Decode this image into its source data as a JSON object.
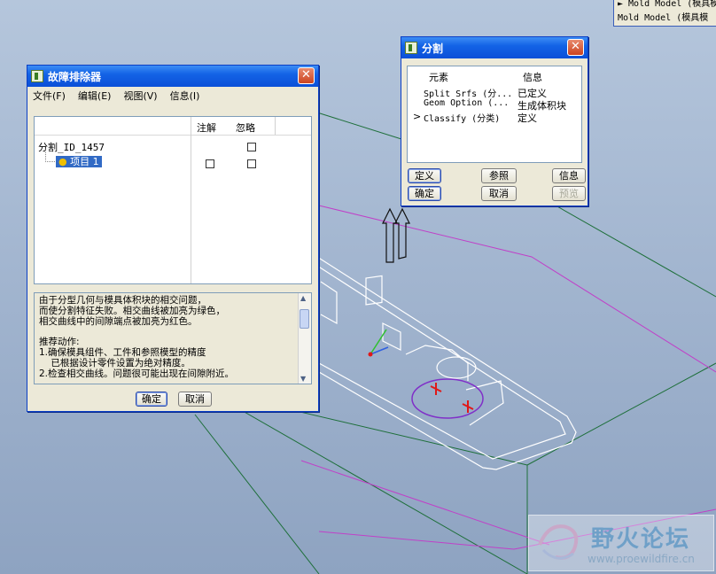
{
  "corner_panel": {
    "line1": "► Mold Model (模具模",
    "line2": "Mold Model (模具模"
  },
  "troubleshooter": {
    "title": "故障排除器",
    "menu": [
      "文件(F)",
      "编辑(E)",
      "视图(V)",
      "信息(I)"
    ],
    "col_note": "注解",
    "col_ignore": "忽略",
    "tree_root": "分割_ID_1457",
    "tree_child": "项目 1",
    "message_lines": [
      "由于分型几何与模具体积块的相交问题，",
      "而使分割特征失败。相交曲线被加亮为绿色，",
      "相交曲线中的间隙端点被加亮为红色。",
      "",
      "推荐动作:",
      "1.确保模具组件、工件和参照模型的精度",
      "    已根据设计零件设置为绝对精度。",
      "2.检查相交曲线。问题很可能出现在间隙附近。"
    ],
    "ok_label": "确定",
    "cancel_label": "取消"
  },
  "split_dialog": {
    "title": "分割",
    "col_element": "元素",
    "col_info": "信息",
    "rows": [
      {
        "marker": "",
        "element": "Split Srfs (分...",
        "info": "已定义"
      },
      {
        "marker": "",
        "element": "Geom Option (...",
        "info": "生成体积块"
      },
      {
        "marker": ">",
        "element": "Classify (分类)",
        "info": "定义"
      }
    ],
    "define_label": "定义",
    "reference_label": "参照",
    "info_label": "信息",
    "ok_label": "确定",
    "cancel_label": "取消",
    "preview_label": "预览"
  },
  "watermark": {
    "name": "野火论坛",
    "url": "www.proewildfire.cn"
  },
  "colors": {
    "title_blue": "#0b4fd8",
    "dialog_bg": "#ece9d8",
    "model_lines": "#ffffff",
    "box_lines": "#1e6f3a",
    "parting_lines": "#c040c8",
    "highlight_red": "#e01818"
  },
  "icons": [
    "app-icon",
    "close-icon",
    "arrow-up-icon",
    "tree-node-icon",
    "scrollbar-grip-icon"
  ]
}
